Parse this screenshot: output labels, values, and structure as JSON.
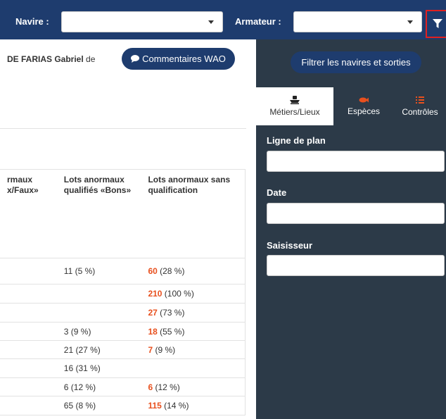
{
  "topbar": {
    "navire_label": "Navire :",
    "navire_value": "",
    "armateur_label": "Armateur :",
    "armateur_value": ""
  },
  "main": {
    "author_name": "DE FARIAS Gabriel",
    "author_suffix": "de",
    "wao_button": "Commentaires WAO",
    "table": {
      "headers": [
        "rmaux\nx/Faux»",
        "Lots anormaux\nqualifiés «Bons»",
        "Lots anormaux sans\nqualification"
      ],
      "rows": [
        {
          "c2": "11 (5 %)",
          "c3_num": "60",
          "c3_pct": " (28 %)"
        },
        {
          "c2": "",
          "c3_num": "210",
          "c3_pct": " (100 %)"
        },
        {
          "c2": "",
          "c3_num": "27",
          "c3_pct": " (73 %)"
        },
        {
          "c2": "3 (9 %)",
          "c3_num": "18",
          "c3_pct": " (55 %)"
        },
        {
          "c2": "21 (27 %)",
          "c3_num": "7",
          "c3_pct": " (9 %)"
        },
        {
          "c2": "16 (31 %)",
          "c3_num": "",
          "c3_pct": ""
        },
        {
          "c2": "6 (12 %)",
          "c3_num": "6",
          "c3_pct": " (12 %)"
        },
        {
          "c2": "65 (8 %)",
          "c3_num": "115",
          "c3_pct": " (14 %)"
        }
      ]
    }
  },
  "panel": {
    "filter_button": "Filtrer les navires et sorties",
    "tabs": [
      {
        "label": "Métiers/Lieux",
        "icon": "boat-icon"
      },
      {
        "label": "Espèces",
        "icon": "fish-icon"
      },
      {
        "label": "Contrôles",
        "icon": "checklist-icon"
      }
    ],
    "fields": [
      {
        "label": "Ligne de plan",
        "value": ""
      },
      {
        "label": "Date",
        "value": ""
      },
      {
        "label": "Saisisseur",
        "value": ""
      }
    ]
  },
  "colors": {
    "navy": "#1e3c6e",
    "panel": "#2c3a48",
    "accent_red": "#e8501e",
    "highlight_border": "#e02020"
  }
}
